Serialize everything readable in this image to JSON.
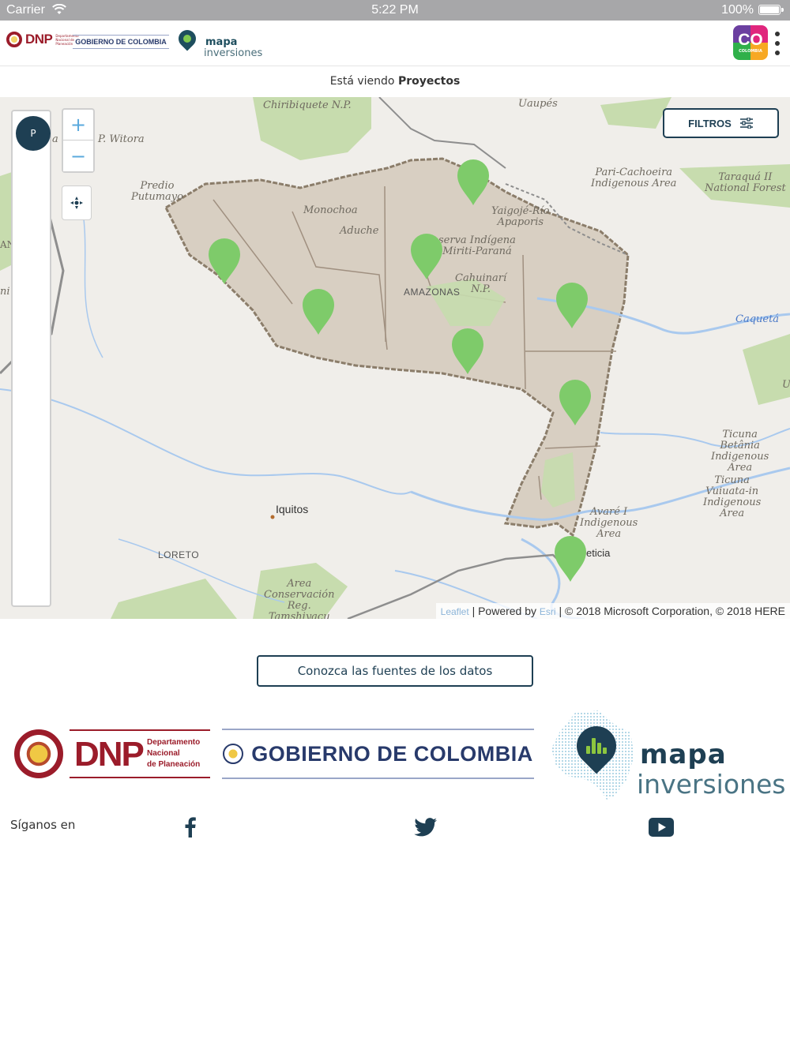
{
  "status_bar": {
    "carrier": "Carrier",
    "time": "5:22 PM",
    "battery": "100%"
  },
  "header": {
    "dnp_logo_text": "DNP",
    "dnp_logo_sub": "Departamento Nacional de Planeación",
    "gobierno_text": "GOBIERNO DE COLOMBIA",
    "mapa_text": "mapa",
    "inversiones_text": "inversiones",
    "co_logo_text": "CO",
    "co_logo_sub": "COLOMBIA"
  },
  "viewing": {
    "prefix": "Está viendo",
    "value": "Proyectos"
  },
  "map": {
    "layer_button_label": "P",
    "zoom_in": "+",
    "zoom_out": "−",
    "filters_label": "FILTROS",
    "labels": {
      "chiribiquete": "Chiribiquete N.P.",
      "uaupes": "Uaupés",
      "witora": "P. Witora",
      "a_left": "a",
      "predio": "Predio\nPutumayo",
      "monochoa": "Monochoa",
      "aduche": "Aduche",
      "yaigoje": "Yaigojé-Río\nApaporis",
      "reserva": "serva Indígena\nMiriti-Paraná",
      "cahuinari": "Cahuinarí\nN.P.",
      "amazonas": "AMAZONAS",
      "pari": "Pari-Cachoeira\nIndigenous Area",
      "taraqua": "Taraquá II\nNational Forest",
      "caqueta": "Caquetá",
      "u_right": "U",
      "an_left": "AN",
      "ni_left": "ni",
      "ticuna_betania": "Ticuna\nBetânia\nIndigenous\nArea",
      "ticuna_vuiuata": "Ticuna\nVuiuata-in\nIndigenous\nArea",
      "avare": "Avaré I\nIndigenous\nArea",
      "leticia": "eticia",
      "iquitos": "Iquitos",
      "loreto": "LORETO",
      "area_conservacion": "Area\nConservación\nReg.\nTamshiyacu"
    },
    "attribution": {
      "leaflet": "Leaflet",
      "powered": "| Powered by",
      "esri": "Esri",
      "copyright": "| © 2018 Microsoft Corporation, © 2018 HERE"
    },
    "colors": {
      "marker": "#7ecb6a",
      "region": "#d8cfc2",
      "border": "#8b7d6a",
      "water": "#a9c9ee",
      "land": "#f0eeea",
      "park": "#c7dcae"
    }
  },
  "sources_button": "Conozca las fuentes de los datos",
  "footer": {
    "dnp": "DNP",
    "dnp_sub_1": "Departamento",
    "dnp_sub_2": "Nacional",
    "dnp_sub_3": "de Planeación",
    "gobierno": "GOBIERNO DE COLOMBIA",
    "mapa": "mapa",
    "inversiones": "inversiones"
  },
  "social": {
    "follow_label": "Síganos en",
    "icons": [
      "facebook-icon",
      "twitter-icon",
      "youtube-icon"
    ]
  }
}
